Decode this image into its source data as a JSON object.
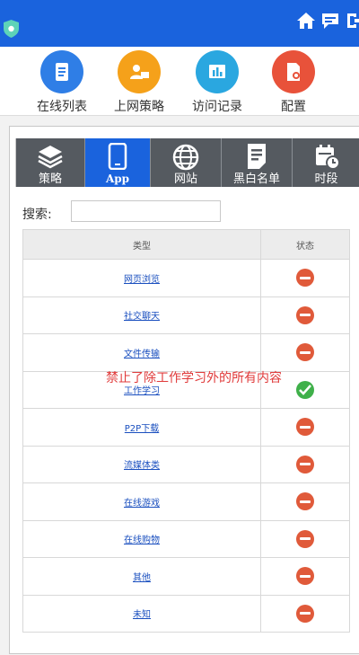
{
  "nav": {
    "items": [
      {
        "label": "在线列表",
        "icon": "list-icon",
        "color": "#2f7ee6"
      },
      {
        "label": "上网策略",
        "icon": "user-policy-icon",
        "color": "#f5a11a"
      },
      {
        "label": "访问记录",
        "icon": "chart-icon",
        "color": "#2aa7e0"
      },
      {
        "label": "配置",
        "icon": "config-icon",
        "color": "#e8523a"
      }
    ]
  },
  "tabs": [
    {
      "label": "策略",
      "icon": "layers-icon"
    },
    {
      "label": "App",
      "icon": "phone-icon",
      "active": true
    },
    {
      "label": "网站",
      "icon": "globe-icon"
    },
    {
      "label": "黑白名单",
      "icon": "document-icon"
    },
    {
      "label": "时段",
      "icon": "calendar-clock-icon"
    }
  ],
  "search": {
    "label": "搜索:",
    "value": ""
  },
  "table": {
    "headers": [
      "类型",
      "状态"
    ],
    "rows": [
      {
        "name": "网页浏览",
        "status": "blocked"
      },
      {
        "name": "社交聊天",
        "status": "blocked"
      },
      {
        "name": "文件传输",
        "status": "blocked"
      },
      {
        "name": "工作学习",
        "status": "allowed"
      },
      {
        "name": "P2P下载",
        "status": "blocked"
      },
      {
        "name": "流媒体类",
        "status": "blocked"
      },
      {
        "name": "在线游戏",
        "status": "blocked"
      },
      {
        "name": "在线购物",
        "status": "blocked"
      },
      {
        "name": "其他",
        "status": "blocked"
      },
      {
        "name": "未知",
        "status": "blocked"
      }
    ]
  },
  "annotation": "禁止了除工作学习外的所有内容",
  "colors": {
    "header": "#1a63dd",
    "blocked": "#e05a3a",
    "allowed": "#3fb04a"
  }
}
